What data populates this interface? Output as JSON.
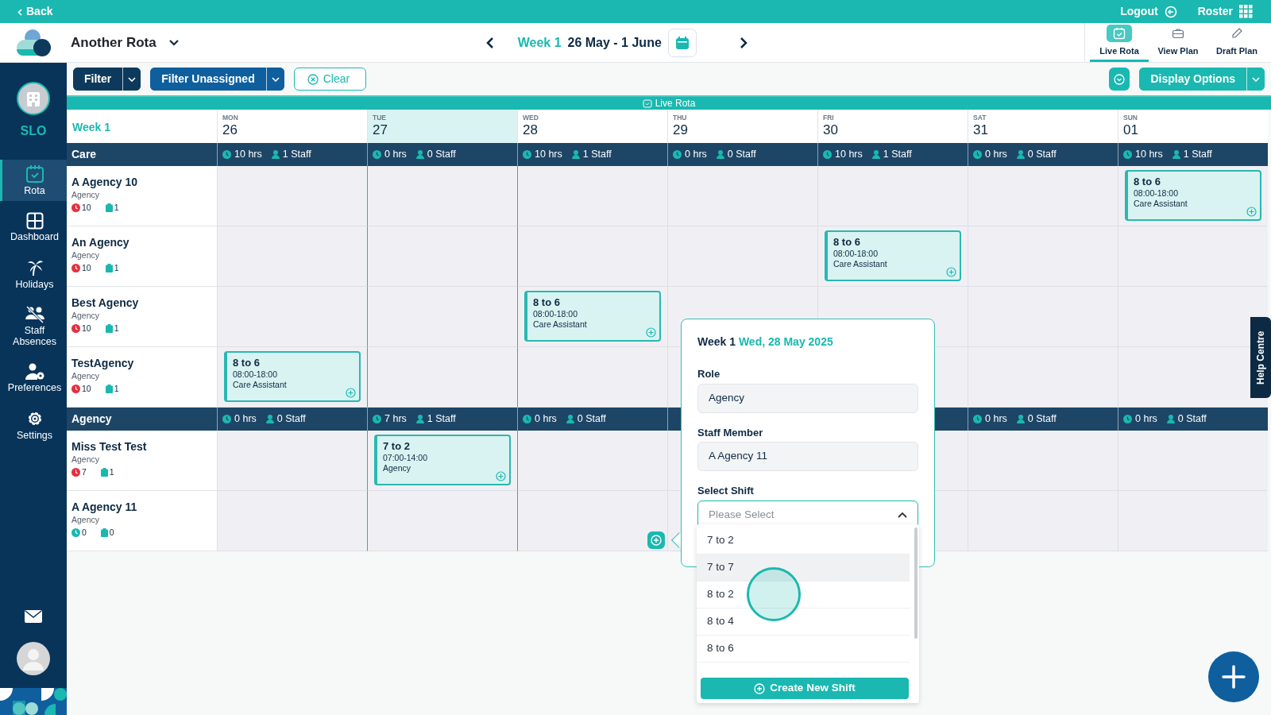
{
  "top_bar": {
    "back": "Back",
    "logout": "Logout",
    "roster": "Roster"
  },
  "header": {
    "rota_name": "Another Rota",
    "week_label": "Week 1",
    "date_range": "26 May - 1 June",
    "view_tabs": [
      {
        "label": "Live Rota",
        "selected": true
      },
      {
        "label": "View Plan",
        "selected": false
      },
      {
        "label": "Draft Plan",
        "selected": false
      }
    ]
  },
  "sidebar": {
    "org": "SLO",
    "items": [
      {
        "label": "Rota",
        "selected": true
      },
      {
        "label": "Dashboard",
        "selected": false
      },
      {
        "label": "Holidays",
        "selected": false
      },
      {
        "label": "Staff Absences",
        "selected": false
      },
      {
        "label": "Preferences",
        "selected": false
      },
      {
        "label": "Settings",
        "selected": false
      }
    ]
  },
  "toolbar": {
    "filter": "Filter",
    "filter_unassigned": "Filter Unassigned",
    "clear": "Clear",
    "display_options": "Display Options"
  },
  "banner": "Live Rota",
  "grid": {
    "week": "Week 1",
    "days": [
      {
        "weekday": "MON",
        "date": "26",
        "selected": false
      },
      {
        "weekday": "TUE",
        "date": "27",
        "selected": true
      },
      {
        "weekday": "WED",
        "date": "28",
        "selected": false
      },
      {
        "weekday": "THU",
        "date": "29",
        "selected": false
      },
      {
        "weekday": "FRI",
        "date": "30",
        "selected": false
      },
      {
        "weekday": "SAT",
        "date": "31",
        "selected": false
      },
      {
        "weekday": "SUN",
        "date": "01",
        "selected": false
      }
    ],
    "groups": [
      {
        "name": "Care",
        "totals": [
          {
            "kind": "summary",
            "hours": "10 hrs",
            "staff": "1 Staff"
          },
          {
            "kind": "summary",
            "hours": "0 hrs",
            "staff": "0 Staff"
          },
          {
            "kind": "summary",
            "hours": "10 hrs",
            "staff": "1 Staff"
          },
          {
            "kind": "summary",
            "hours": "0 hrs",
            "staff": "0 Staff"
          },
          {
            "kind": "summary",
            "hours": "10 hrs",
            "staff": "1 Staff"
          },
          {
            "kind": "summary",
            "hours": "0 hrs",
            "staff": "0 Staff"
          },
          {
            "kind": "summary",
            "hours": "10 hrs",
            "staff": "1 Staff"
          }
        ],
        "staff": [
          {
            "name": "A Agency 10",
            "role": "Agency",
            "hours": "10",
            "color": "#e5303e",
            "shifts": "1",
            "cells": [
              {
                "kind": "empty"
              },
              {
                "kind": "empty"
              },
              {
                "kind": "empty"
              },
              {
                "kind": "empty"
              },
              {
                "kind": "empty"
              },
              {
                "kind": "empty"
              },
              {
                "kind": "shift",
                "title": "8 to 6",
                "time": "08:00-18:00",
                "role": "Care Assistant"
              }
            ]
          },
          {
            "name": "An Agency",
            "role": "Agency",
            "hours": "10",
            "color": "#e5303e",
            "shifts": "1",
            "cells": [
              {
                "kind": "empty"
              },
              {
                "kind": "empty"
              },
              {
                "kind": "empty"
              },
              {
                "kind": "empty"
              },
              {
                "kind": "shift",
                "title": "8 to 6",
                "time": "08:00-18:00",
                "role": "Care Assistant"
              },
              {
                "kind": "empty"
              },
              {
                "kind": "empty"
              }
            ]
          },
          {
            "name": "Best Agency",
            "role": "Agency",
            "hours": "10",
            "color": "#e5303e",
            "shifts": "1",
            "cells": [
              {
                "kind": "empty"
              },
              {
                "kind": "empty"
              },
              {
                "kind": "shift",
                "title": "8 to 6",
                "time": "08:00-18:00",
                "role": "Care Assistant"
              },
              {
                "kind": "empty"
              },
              {
                "kind": "empty"
              },
              {
                "kind": "empty"
              },
              {
                "kind": "empty"
              }
            ]
          },
          {
            "name": "TestAgency",
            "role": "Agency",
            "hours": "10",
            "color": "#e5303e",
            "shifts": "1",
            "cells": [
              {
                "kind": "shift",
                "title": "8 to 6",
                "time": "08:00-18:00",
                "role": "Care Assistant"
              },
              {
                "kind": "empty"
              },
              {
                "kind": "empty"
              },
              {
                "kind": "empty"
              },
              {
                "kind": "empty"
              },
              {
                "kind": "empty"
              },
              {
                "kind": "empty"
              }
            ]
          }
        ]
      },
      {
        "name": "Agency",
        "totals": [
          {
            "kind": "summary",
            "hours": "0 hrs",
            "staff": "0 Staff"
          },
          {
            "kind": "summary",
            "hours": "7 hrs",
            "staff": "1 Staff"
          },
          {
            "kind": "summary",
            "hours": "0 hrs",
            "staff": "0 Staff"
          },
          {
            "kind": "covered"
          },
          {
            "kind": "covered"
          },
          {
            "kind": "summary",
            "hours": "0 hrs",
            "staff": "0 Staff"
          },
          {
            "kind": "summary",
            "hours": "0 hrs",
            "staff": "0 Staff"
          }
        ],
        "staff": [
          {
            "name": "Miss Test Test",
            "role": "Agency",
            "hours": "7",
            "color": "#e5303e",
            "shifts": "1",
            "cells": [
              {
                "kind": "empty"
              },
              {
                "kind": "shift",
                "title": "7 to 2",
                "time": "07:00-14:00",
                "role": "Agency"
              },
              {
                "kind": "empty"
              },
              {
                "kind": "empty"
              },
              {
                "kind": "empty"
              },
              {
                "kind": "empty"
              },
              {
                "kind": "empty"
              }
            ]
          },
          {
            "name": "A Agency 11",
            "role": "Agency",
            "hours": "0",
            "color": "#1ab8b0",
            "shifts": "0",
            "cells": [
              {
                "kind": "empty"
              },
              {
                "kind": "empty"
              },
              {
                "kind": "empty"
              },
              {
                "kind": "empty"
              },
              {
                "kind": "empty"
              },
              {
                "kind": "empty"
              },
              {
                "kind": "empty"
              }
            ]
          }
        ]
      }
    ]
  },
  "popup": {
    "week": "Week 1",
    "date": "Wed, 28 May 2025",
    "fields": [
      {
        "label": "Role",
        "value": "Agency"
      },
      {
        "label": "Staff Member",
        "value": "A Agency 11"
      }
    ],
    "shift_label": "Select Shift",
    "shift_placeholder": "Please Select",
    "options": [
      {
        "label": "7 to 2",
        "highlighted": false
      },
      {
        "label": "7 to 7",
        "highlighted": true
      },
      {
        "label": "8 to 2",
        "highlighted": false
      },
      {
        "label": "8 to 4",
        "highlighted": false
      },
      {
        "label": "8 to 6",
        "highlighted": false
      }
    ],
    "create": "Create New Shift"
  },
  "help": "Help Centre"
}
